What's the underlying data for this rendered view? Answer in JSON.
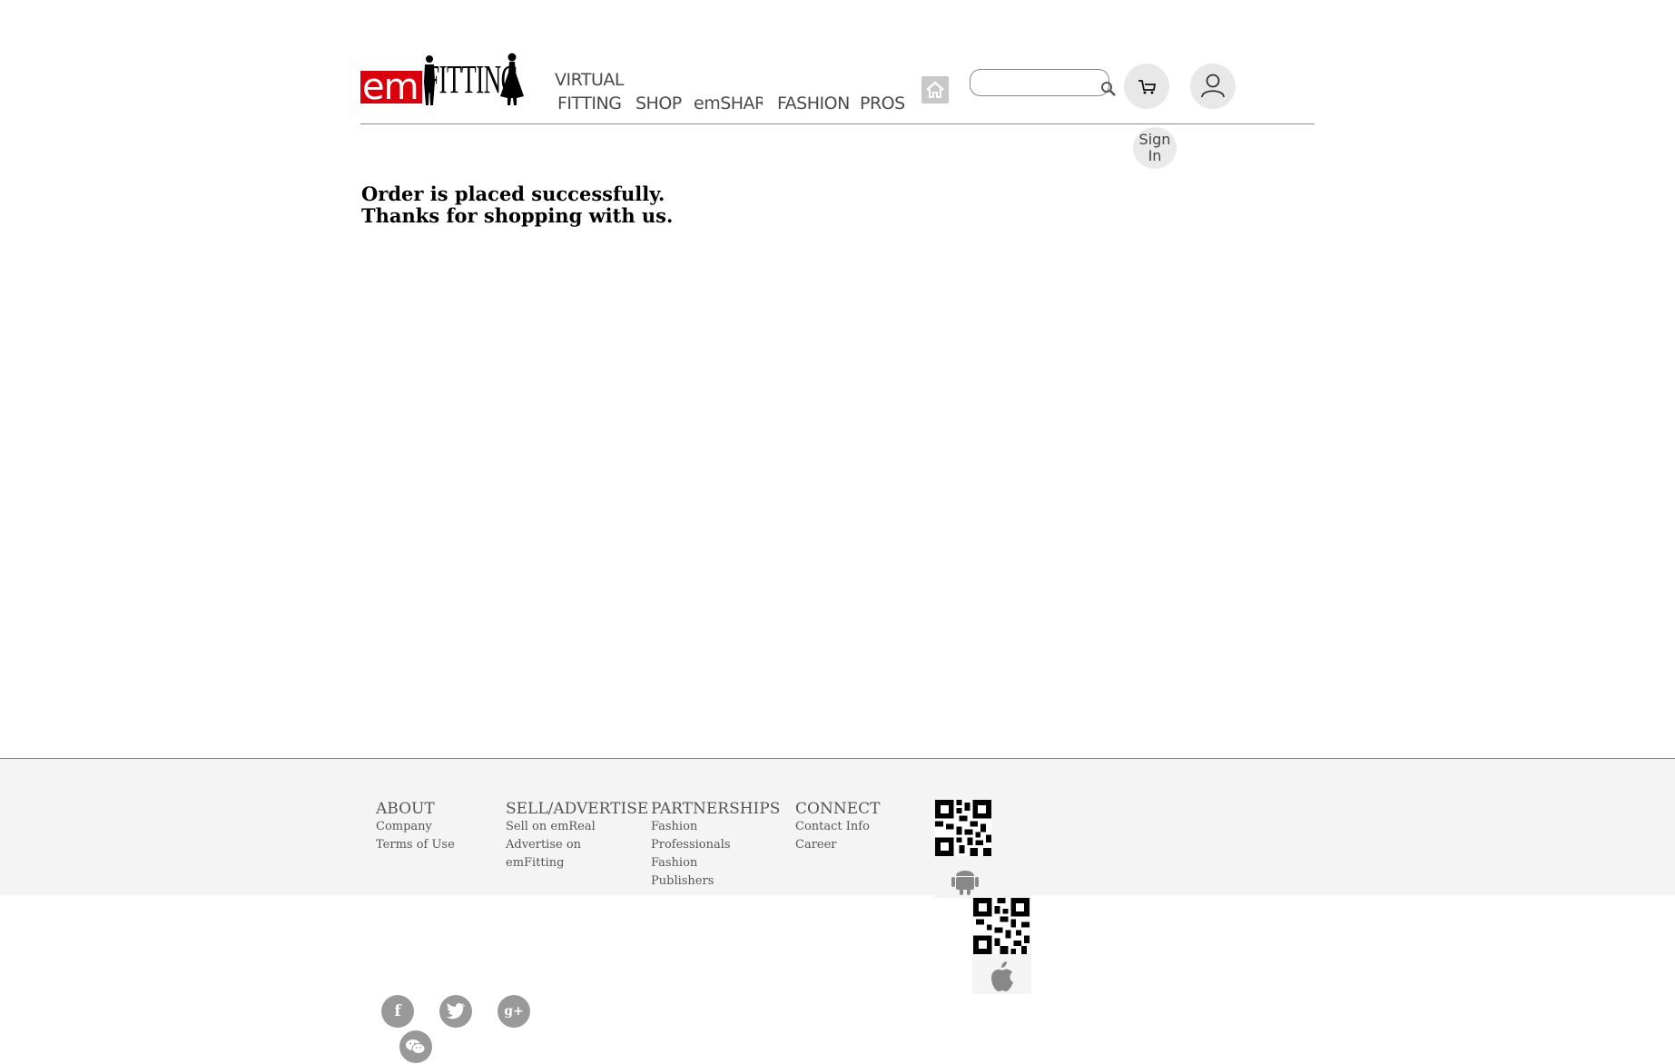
{
  "header": {
    "logo_em": "em",
    "logo_fitting": "FITTING",
    "nav": {
      "virtual": "VIRTUAL",
      "fitting": "FITTING",
      "shop": "SHOP",
      "emshare": "emSHARE",
      "fashion": "FASHION",
      "pros": "PROS"
    },
    "search_placeholder": "",
    "signin_line1": "Sign",
    "signin_line2": "In"
  },
  "main": {
    "message_line1": "Order is placed successfully.",
    "message_line2": "Thanks for shopping with us."
  },
  "footer": {
    "about": {
      "title": "ABOUT",
      "links": [
        "Company",
        "Terms of Use"
      ]
    },
    "sell": {
      "title": "SELL/ADVERTISE",
      "links": [
        "Sell on emReal",
        "Advertise on",
        "emFitting"
      ]
    },
    "partnerships": {
      "title": "PARTNERSHIPS",
      "links": [
        "Fashion",
        "Professionals",
        "Fashion",
        "Publishers"
      ]
    },
    "connect": {
      "title": "CONNECT",
      "links": [
        "Contact Info",
        "Career"
      ]
    },
    "social": {
      "facebook": "f",
      "twitter": "twitter-icon",
      "googleplus": "g+",
      "wechat": "wechat-icon"
    }
  },
  "colors": {
    "brand_red": "#d9000d",
    "footer_bg": "#f4f4f4",
    "icon_grey": "#999999"
  }
}
